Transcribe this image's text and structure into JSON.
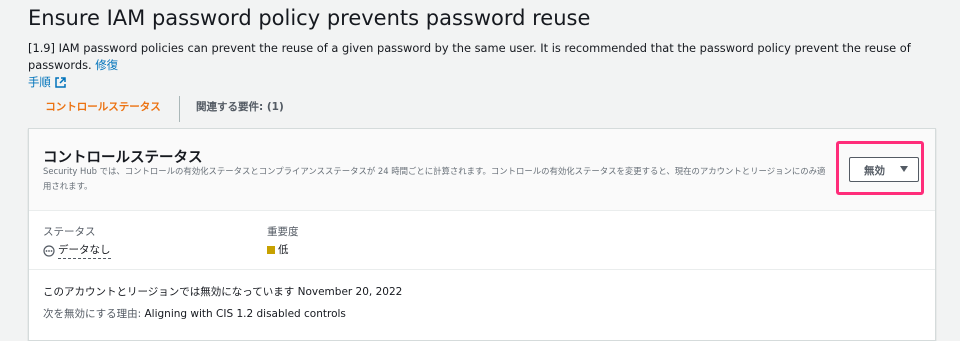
{
  "page": {
    "title": "Ensure IAM password policy prevents password reuse",
    "description": "[1.9] IAM password policies can prevent the reuse of a given password by the same user. It is recommended that the password policy prevent the reuse of passwords.",
    "remediation_link_line1": "修復",
    "remediation_link_line2": "手順"
  },
  "tabs": [
    {
      "label": "コントロールステータス",
      "active": true
    },
    {
      "label": "関連する要件: (1)",
      "active": false
    }
  ],
  "control_status": {
    "heading": "コントロールステータス",
    "description": "Security Hub では、コントロールの有効化ステータスとコンプライアンスステータスが 24 時間ごとに計算されます。コントロールの有効化ステータスを変更すると、現在のアカウントとリージョンにのみ適用されます。",
    "dropdown_value": "無効",
    "status_label": "ステータス",
    "status_value": "データなし",
    "severity_label": "重要度",
    "severity_value": "低",
    "severity_color": "#c7a100",
    "disabled_message": "このアカウントとリージョンでは無効になっています November 20, 2022",
    "reason_label": "次を無効にする理由:",
    "reason_value": "Aligning with CIS 1.2 disabled controls"
  },
  "colors": {
    "accent": "#ec7211",
    "link": "#0073bb",
    "highlight": "#ff2d7a"
  },
  "icons": {
    "external": "external-link-icon",
    "status": "no-data-icon",
    "caret": "caret-down-icon"
  }
}
